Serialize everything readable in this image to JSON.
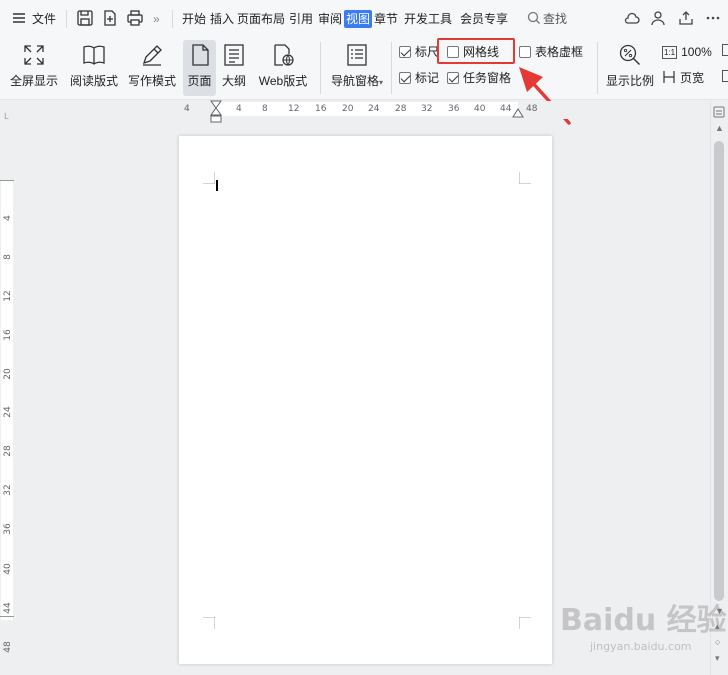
{
  "menubar": {
    "file_label": "文件",
    "tabs": [
      "开始",
      "插入",
      "页面布局",
      "引用",
      "审阅",
      "视图",
      "章节",
      "开发工具",
      "会员专享"
    ],
    "active_tab_index": 5,
    "search_label": "查找",
    "more_glyph": "»"
  },
  "ribbon": {
    "buttons": [
      {
        "label": "全屏显示",
        "icon": "fullscreen-icon"
      },
      {
        "label": "阅读版式",
        "icon": "book-icon"
      },
      {
        "label": "写作模式",
        "icon": "pen-icon"
      },
      {
        "label": "页面",
        "icon": "page-icon",
        "active": true
      },
      {
        "label": "大纲",
        "icon": "outline-icon"
      },
      {
        "label": "Web版式",
        "icon": "web-icon"
      },
      {
        "label": "导航窗格",
        "icon": "nav-pane-icon"
      }
    ],
    "checkboxes": {
      "ruler": {
        "label": "标尺",
        "checked": true
      },
      "gridlines": {
        "label": "网格线",
        "checked": false
      },
      "table_border": {
        "label": "表格虚框",
        "checked": false
      },
      "marks": {
        "label": "标记",
        "checked": true
      },
      "task_pane": {
        "label": "任务窗格",
        "checked": true
      }
    },
    "zoom_label": "显示比例",
    "zoom_value": "100%",
    "zoom_prefix": "1:1",
    "page_width_label": "页宽"
  },
  "ruler": {
    "h_ticks": [
      "4",
      "4",
      "8",
      "12",
      "16",
      "20",
      "24",
      "28",
      "32",
      "36",
      "40",
      "44",
      "48"
    ],
    "v_ticks": [
      "4",
      "8",
      "12",
      "16",
      "20",
      "24",
      "28",
      "32",
      "36",
      "40",
      "44",
      "48"
    ]
  },
  "watermark": {
    "main": "Baidu 经验",
    "sub": "jingyan.baidu.com"
  },
  "colors": {
    "accent": "#3b7cf5",
    "highlight": "#e53935",
    "arrow": "#e53935"
  }
}
